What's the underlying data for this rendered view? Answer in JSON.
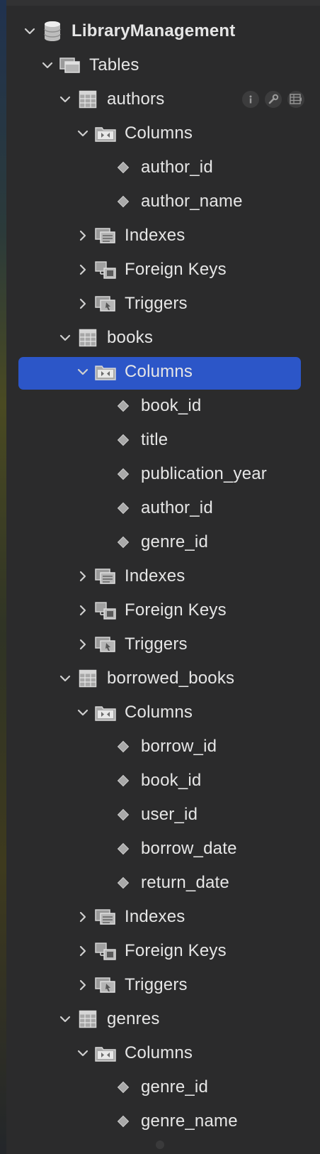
{
  "tree": {
    "database": "LibraryManagement",
    "tables_label": "Tables",
    "tables": [
      {
        "name": "authors",
        "columns_label": "Columns",
        "columns": [
          "author_id",
          "author_name"
        ],
        "indexes_label": "Indexes",
        "foreign_keys_label": "Foreign Keys",
        "triggers_label": "Triggers"
      },
      {
        "name": "books",
        "columns_label": "Columns",
        "columns": [
          "book_id",
          "title",
          "publication_year",
          "author_id",
          "genre_id"
        ],
        "indexes_label": "Indexes",
        "foreign_keys_label": "Foreign Keys",
        "triggers_label": "Triggers"
      },
      {
        "name": "borrowed_books",
        "columns_label": "Columns",
        "columns": [
          "borrow_id",
          "book_id",
          "user_id",
          "borrow_date",
          "return_date"
        ],
        "indexes_label": "Indexes",
        "foreign_keys_label": "Foreign Keys",
        "triggers_label": "Triggers"
      },
      {
        "name": "genres",
        "columns_label": "Columns",
        "columns": [
          "genre_id",
          "genre_name"
        ]
      }
    ]
  },
  "selected": "books.columns",
  "colors": {
    "selection": "#2c56c8",
    "panel": "#2b2b2c",
    "text": "#e6e6e6"
  },
  "icons": {
    "database": "database-icon",
    "tables": "tables-folder-icon",
    "table": "table-grid-icon",
    "columns": "columns-folder-icon",
    "column": "column-diamond-icon",
    "indexes": "indexes-icon",
    "foreign_keys": "foreign-keys-icon",
    "triggers": "triggers-icon",
    "info": "info-icon",
    "wrench": "wrench-icon",
    "table_data": "table-data-icon"
  }
}
